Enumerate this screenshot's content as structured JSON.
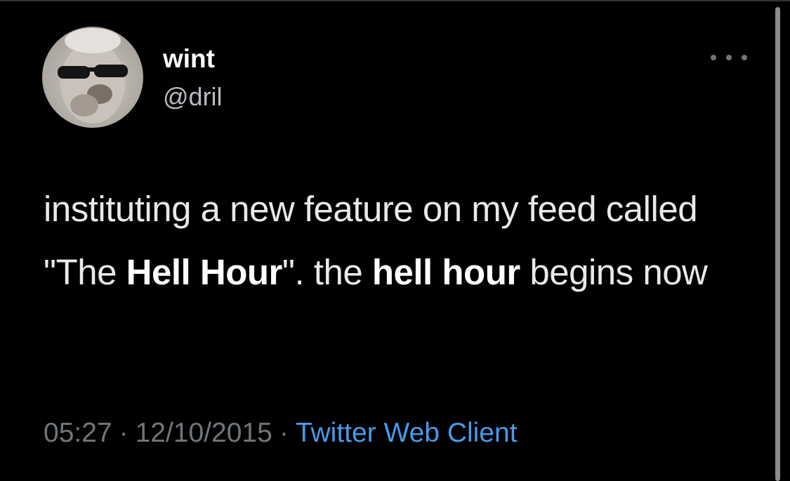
{
  "author": {
    "display_name": "wint",
    "handle": "@dril",
    "avatar_icon": "profile-photo"
  },
  "tweet": {
    "segments": [
      {
        "text": "instituting a new feature on my feed called \"The ",
        "bold": false
      },
      {
        "text": "Hell Hour",
        "bold": true
      },
      {
        "text": "\". the ",
        "bold": false
      },
      {
        "text": "hell hour",
        "bold": true
      },
      {
        "text": " begins now",
        "bold": false
      }
    ]
  },
  "meta": {
    "time": "05:27",
    "separator": "·",
    "date": "12/10/2015",
    "client": "Twitter Web Client"
  },
  "icons": {
    "more": "more-horizontal-icon"
  },
  "colors": {
    "background": "#000000",
    "text": "#e7e9ea",
    "muted": "#71767b",
    "link": "#4a99e9"
  }
}
